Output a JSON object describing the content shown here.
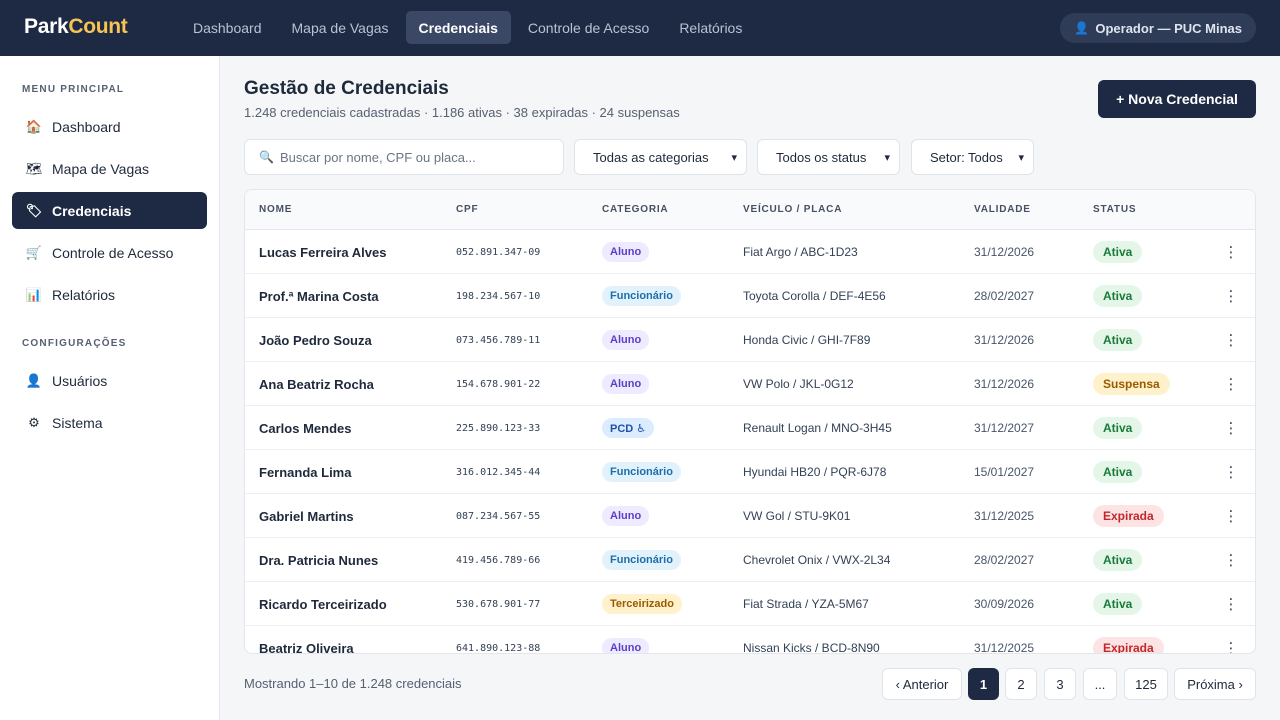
{
  "app": {
    "logo_part1": "Park",
    "logo_part2": "Count"
  },
  "topnav": [
    {
      "label": "Dashboard"
    },
    {
      "label": "Mapa de Vagas"
    },
    {
      "label": "Credenciais"
    },
    {
      "label": "Controle de Acesso"
    },
    {
      "label": "Relatórios"
    }
  ],
  "topnav_active": "Credenciais",
  "operator": {
    "icon": "user-icon",
    "label": "Operador — PUC Minas"
  },
  "sidebar": {
    "section_main": "MENU PRINCIPAL",
    "items": [
      {
        "icon": "house-icon",
        "glyph": "🏠",
        "label": "Dashboard"
      },
      {
        "icon": "map-icon",
        "glyph": "🗺",
        "label": "Mapa de Vagas"
      },
      {
        "icon": "badge-icon",
        "glyph": "🏷",
        "label": "Credenciais"
      },
      {
        "icon": "cart-icon",
        "glyph": "🛒",
        "label": "Controle de Acesso"
      },
      {
        "icon": "bar-chart-icon",
        "glyph": "📊",
        "label": "Relatórios"
      }
    ],
    "section_config": "CONFIGURAÇÕES",
    "config_items": [
      {
        "icon": "user-icon",
        "glyph": "👤",
        "label": "Usuários"
      },
      {
        "icon": "gear-icon",
        "glyph": "⚙",
        "label": "Sistema"
      }
    ]
  },
  "header": {
    "title": "Gestão de Credenciais",
    "subtitle": "1.248 credenciais cadastradas · 1.186 ativas · 38 expiradas · 24 suspensas",
    "new_button": "+ Nova Credencial"
  },
  "filters": {
    "search_placeholder": "Buscar por nome, CPF ou placa...",
    "category": "Todas as categorias",
    "status": "Todos os status",
    "sector": "Setor: Todos"
  },
  "table": {
    "columns": [
      "NOME",
      "CPF",
      "CATEGORIA",
      "VEÍCULO / PLACA",
      "VALIDADE",
      "STATUS"
    ],
    "rows": [
      {
        "name": "Lucas Ferreira Alves",
        "cpf": "052.891.347-09",
        "category": "Aluno",
        "vehicle": "Fiat Argo / ABC-1D23",
        "validity": "31/12/2026",
        "status": "Ativa"
      },
      {
        "name": "Prof.ª Marina Costa",
        "cpf": "198.234.567-10",
        "category": "Funcionário",
        "vehicle": "Toyota Corolla / DEF-4E56",
        "validity": "28/02/2027",
        "status": "Ativa"
      },
      {
        "name": "João Pedro Souza",
        "cpf": "073.456.789-11",
        "category": "Aluno",
        "vehicle": "Honda Civic / GHI-7F89",
        "validity": "31/12/2026",
        "status": "Ativa"
      },
      {
        "name": "Ana Beatriz Rocha",
        "cpf": "154.678.901-22",
        "category": "Aluno",
        "vehicle": "VW Polo / JKL-0G12",
        "validity": "31/12/2026",
        "status": "Suspensa"
      },
      {
        "name": "Carlos Mendes",
        "cpf": "225.890.123-33",
        "category": "PCD ♿",
        "vehicle": "Renault Logan / MNO-3H45",
        "validity": "31/12/2027",
        "status": "Ativa"
      },
      {
        "name": "Fernanda Lima",
        "cpf": "316.012.345-44",
        "category": "Funcionário",
        "vehicle": "Hyundai HB20 / PQR-6J78",
        "validity": "15/01/2027",
        "status": "Ativa"
      },
      {
        "name": "Gabriel Martins",
        "cpf": "087.234.567-55",
        "category": "Aluno",
        "vehicle": "VW Gol / STU-9K01",
        "validity": "31/12/2025",
        "status": "Expirada"
      },
      {
        "name": "Dra. Patricia Nunes",
        "cpf": "419.456.789-66",
        "category": "Funcionário",
        "vehicle": "Chevrolet Onix / VWX-2L34",
        "validity": "28/02/2027",
        "status": "Ativa"
      },
      {
        "name": "Ricardo Terceirizado",
        "cpf": "530.678.901-77",
        "category": "Terceirizado",
        "vehicle": "Fiat Strada / YZA-5M67",
        "validity": "30/09/2026",
        "status": "Ativa"
      },
      {
        "name": "Beatriz Oliveira",
        "cpf": "641.890.123-88",
        "category": "Aluno",
        "vehicle": "Nissan Kicks / BCD-8N90",
        "validity": "31/12/2025",
        "status": "Expirada"
      }
    ],
    "row_action_icon": "more-vertical-icon"
  },
  "footer": {
    "showing": "Mostrando 1–10 de 1.248 credenciais",
    "prev": "‹ Anterior",
    "pages": [
      "1",
      "2",
      "3",
      "...",
      "125"
    ],
    "next": "Próxima ›",
    "current_page": "1"
  },
  "colors": {
    "navbar": "#1e2a44",
    "accent_logo": "#f6c453",
    "active_green": "#1b7a3a",
    "expired_red": "#c2262c",
    "suspended_amber": "#9a5a00"
  }
}
